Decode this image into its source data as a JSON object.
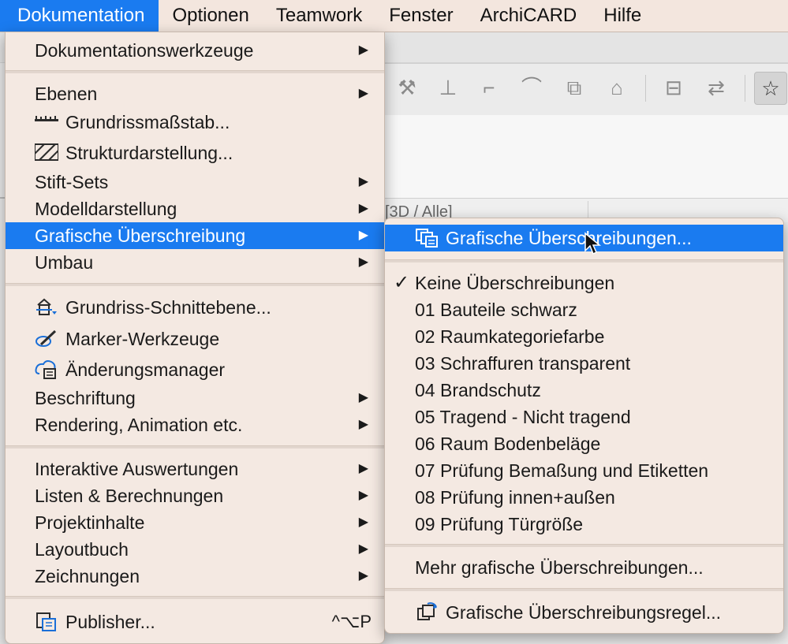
{
  "menubar": {
    "items": [
      "Dokumentation",
      "Optionen",
      "Teamwork",
      "Fenster",
      "ArchiCARD",
      "Hilfe"
    ]
  },
  "background": {
    "view_tab_text": "[3D / Alle]"
  },
  "main_menu": {
    "items": [
      {
        "label": "Dokumentationswerkzeuge",
        "submenu": true
      },
      {
        "label": "Ebenen",
        "submenu": true
      },
      {
        "label": "Grundrissmaßstab...",
        "icon": "scale-ruler-icon"
      },
      {
        "label": "Strukturdarstellung...",
        "icon": "hatch-pattern-icon"
      },
      {
        "label": "Stift-Sets",
        "submenu": true
      },
      {
        "label": "Modelldarstellung",
        "submenu": true
      },
      {
        "label": "Grafische Überschreibung",
        "submenu": true,
        "highlighted": true
      },
      {
        "label": "Umbau",
        "submenu": true
      },
      {
        "label": "Grundriss-Schnittebene...",
        "icon": "cut-plane-icon"
      },
      {
        "label": "Marker-Werkzeuge",
        "icon": "marker-pen-icon"
      },
      {
        "label": "Änderungsmanager",
        "icon": "change-manager-icon"
      },
      {
        "label": "Beschriftung",
        "submenu": true
      },
      {
        "label": "Rendering, Animation etc.",
        "submenu": true
      },
      {
        "label": "Interaktive Auswertungen",
        "submenu": true
      },
      {
        "label": "Listen & Berechnungen",
        "submenu": true
      },
      {
        "label": "Projektinhalte",
        "submenu": true
      },
      {
        "label": "Layoutbuch",
        "submenu": true
      },
      {
        "label": "Zeichnungen",
        "submenu": true
      },
      {
        "label": "Publisher...",
        "icon": "publisher-icon",
        "shortcut": "^⌥P"
      }
    ]
  },
  "sub_menu": {
    "items": [
      {
        "label": "Grafische Überschreibungen...",
        "icon": "override-dialog-icon",
        "highlighted": true
      },
      {
        "label": "Keine Überschreibungen",
        "checked": true
      },
      {
        "label": "01 Bauteile schwarz"
      },
      {
        "label": "02 Raumkategoriefarbe"
      },
      {
        "label": "03 Schraffuren transparent"
      },
      {
        "label": "04 Brandschutz"
      },
      {
        "label": "05 Tragend - Nicht tragend"
      },
      {
        "label": "06 Raum Bodenbeläge"
      },
      {
        "label": "07 Prüfung Bemaßung und Etiketten"
      },
      {
        "label": "08 Prüfung innen+außen"
      },
      {
        "label": "09 Prüfung Türgröße"
      },
      {
        "label": "Mehr grafische Überschreibungen..."
      },
      {
        "label": "Grafische Überschreibungsregel...",
        "icon": "override-rule-icon"
      }
    ]
  },
  "colors": {
    "highlight": "#1a7bf0",
    "menu_bg": "#f4e9e2",
    "menubar_bg": "#f3e6de"
  }
}
